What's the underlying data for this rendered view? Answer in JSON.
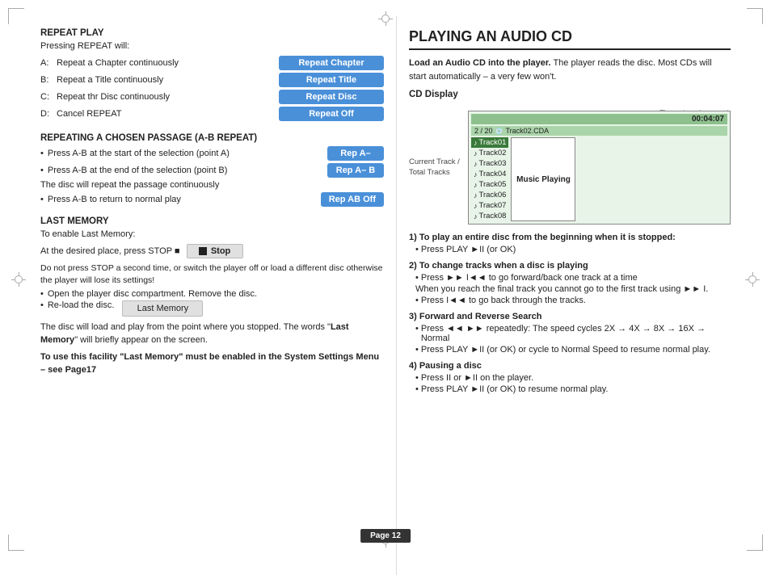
{
  "page": {
    "number": "Page 12"
  },
  "left": {
    "repeat_play": {
      "title": "REPEAT PLAY",
      "subtitle": "Pressing REPEAT will:",
      "items": [
        {
          "key": "A:",
          "description": "Repeat a Chapter continuously",
          "badge": "Repeat Chapter"
        },
        {
          "key": "B:",
          "description": "Repeat a Title continuously",
          "badge": "Repeat Title"
        },
        {
          "key": "C:",
          "description": "Repeat thr Disc continuously",
          "badge": "Repeat Disc"
        },
        {
          "key": "D:",
          "description": "Cancel REPEAT",
          "badge": "Repeat Off"
        }
      ]
    },
    "ab_repeat": {
      "title": "REPEATING A CHOSEN PASSAGE (A-B Repeat)",
      "items": [
        {
          "bullet": "•",
          "text": "Press A-B at the start of the selection (point A)",
          "badge": "Rep A–"
        },
        {
          "bullet": "•",
          "text": "Press A-B at the end of the selection (point B)",
          "badge": "Rep A– B"
        }
      ],
      "note": "The disc will repeat the passage continuously",
      "last_item": {
        "bullet": "•",
        "text": "Press A-B to return to normal play",
        "badge": "Rep AB Off"
      }
    },
    "last_memory": {
      "title": "LAST MEMORY",
      "subtitle": "To enable Last Memory:",
      "stop_instruction": "At the desired place, press STOP ■",
      "stop_badge": "Stop",
      "note1": "Do not press STOP a second time, or switch the player off or load a different disc otherwise the player will lose its settings!",
      "bullet1": "Open the player disc compartment. Remove the disc.",
      "bullet2": "Re-load the disc.",
      "lm_badge": "Last Memory",
      "final_text1": "The disc will load and play from the point where you stopped. The words \"",
      "final_bold": "Last Memory",
      "final_text2": "\" will briefly appear on the screen.",
      "final_note": "To use this facility \"Last Memory\" must be enabled in the System Settings Menu – see Page17"
    }
  },
  "right": {
    "title": "PLAYING AN AUDIO CD",
    "intro_bold": "Load an Audio CD into the player.",
    "intro_rest": " The player reads the disc. Most CDs will start automatically – a very few won't.",
    "time_played_label": "Time played on track",
    "cd_display_label": "CD Display",
    "cd": {
      "time": "00:04:07",
      "track_info": "2 / 20",
      "disc_label": "Track02.CDA",
      "tracks": [
        {
          "label": "Track01",
          "selected": true
        },
        {
          "label": "Track02",
          "selected": false
        },
        {
          "label": "Track03",
          "selected": false
        },
        {
          "label": "Track04",
          "selected": false
        },
        {
          "label": "Track05",
          "selected": false
        },
        {
          "label": "Track06",
          "selected": false
        },
        {
          "label": "Track07",
          "selected": false
        },
        {
          "label": "Track08",
          "selected": false
        }
      ],
      "music_playing": "Music Playing",
      "current_track_label": "Current Track /\nTotal Tracks"
    },
    "sections": [
      {
        "num": "1)",
        "title": "To play an entire disc from the beginning when it is stopped:",
        "items": [
          {
            "bullet": "•",
            "text": "Press PLAY ►II (or OK)"
          }
        ]
      },
      {
        "num": "2)",
        "title": "To  change tracks when a disc is playing",
        "items": [
          {
            "bullet": "•",
            "text": "Press ►► I◄◄ to go forward/back one track at a time"
          }
        ]
      },
      {
        "num": "3",
        "title": "Forward and Reverse Search",
        "items": [
          {
            "bullet": "•",
            "text": "Press ◄◄ ►► repeatedly: The speed cycles  2X → 4X → 8X → 16X → Normal"
          },
          {
            "bullet": "•",
            "text": "Press PLAY ►II (or OK) or cycle to Normal Speed to resume normal play."
          }
        ]
      },
      {
        "num": "4)",
        "title": "Pausing a disc",
        "items": [
          {
            "bullet": "•",
            "text": "Press II or ►II on the player."
          },
          {
            "bullet": "•",
            "text": "Press PLAY ►II (or OK) to resume normal play."
          }
        ]
      }
    ],
    "track_note": "When you reach the final track you cannot go to the first track using ►► I.",
    "back_note": "• Press I◄◄ to go back through the tracks."
  }
}
